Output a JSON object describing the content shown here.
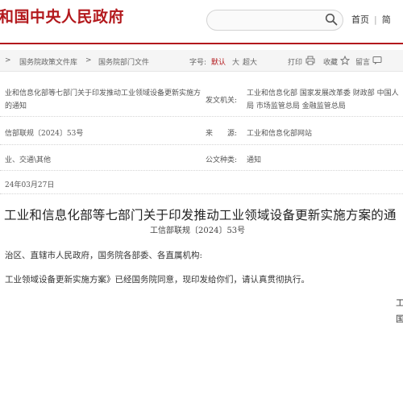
{
  "header": {
    "site_title": "和国中央人民政府",
    "search_placeholder": "",
    "nav": [
      "首页",
      "简"
    ]
  },
  "breadcrumb": {
    "items": [
      "国务院政策文件库",
      "国务院部门文件"
    ],
    "separator": ">",
    "font_size_label": "字号:",
    "font_default": "默认",
    "font_large": "大",
    "font_xlarge": "超大",
    "print": "打印",
    "favorite": "收藏",
    "comment": "留言"
  },
  "info": {
    "title_line1": "业和信息化部等七部门关于印发推动工业领域设备更新实施方",
    "title_line2": "的通知",
    "issuer_label": "发文机关:",
    "issuer_line1": "工业和信息化部  国家发展改革委  财政部  中国人",
    "issuer_line2": "局  市场监管总局  金融监管总局",
    "docno": "信部联规〔2024〕53号",
    "source_label": "来　　源:",
    "source": "工业和信息化部网站",
    "category": "业、交通\\其他",
    "doctype_label": "公文种类:",
    "doctype": "通知",
    "date": "24年03月27日"
  },
  "article": {
    "title": "工业和信息化部等七部门关于印发推动工业领域设备更新实施方案的通",
    "docno": "工信部联规〔2024〕53号",
    "para1": "治区、直辖市人民政府，国务院各部委、各直属机构:",
    "para2": "工业领域设备更新实施方案》已经国务院同意，现印发给你们，请认真贯彻执行。",
    "sign1": "工",
    "sign2": "国"
  }
}
